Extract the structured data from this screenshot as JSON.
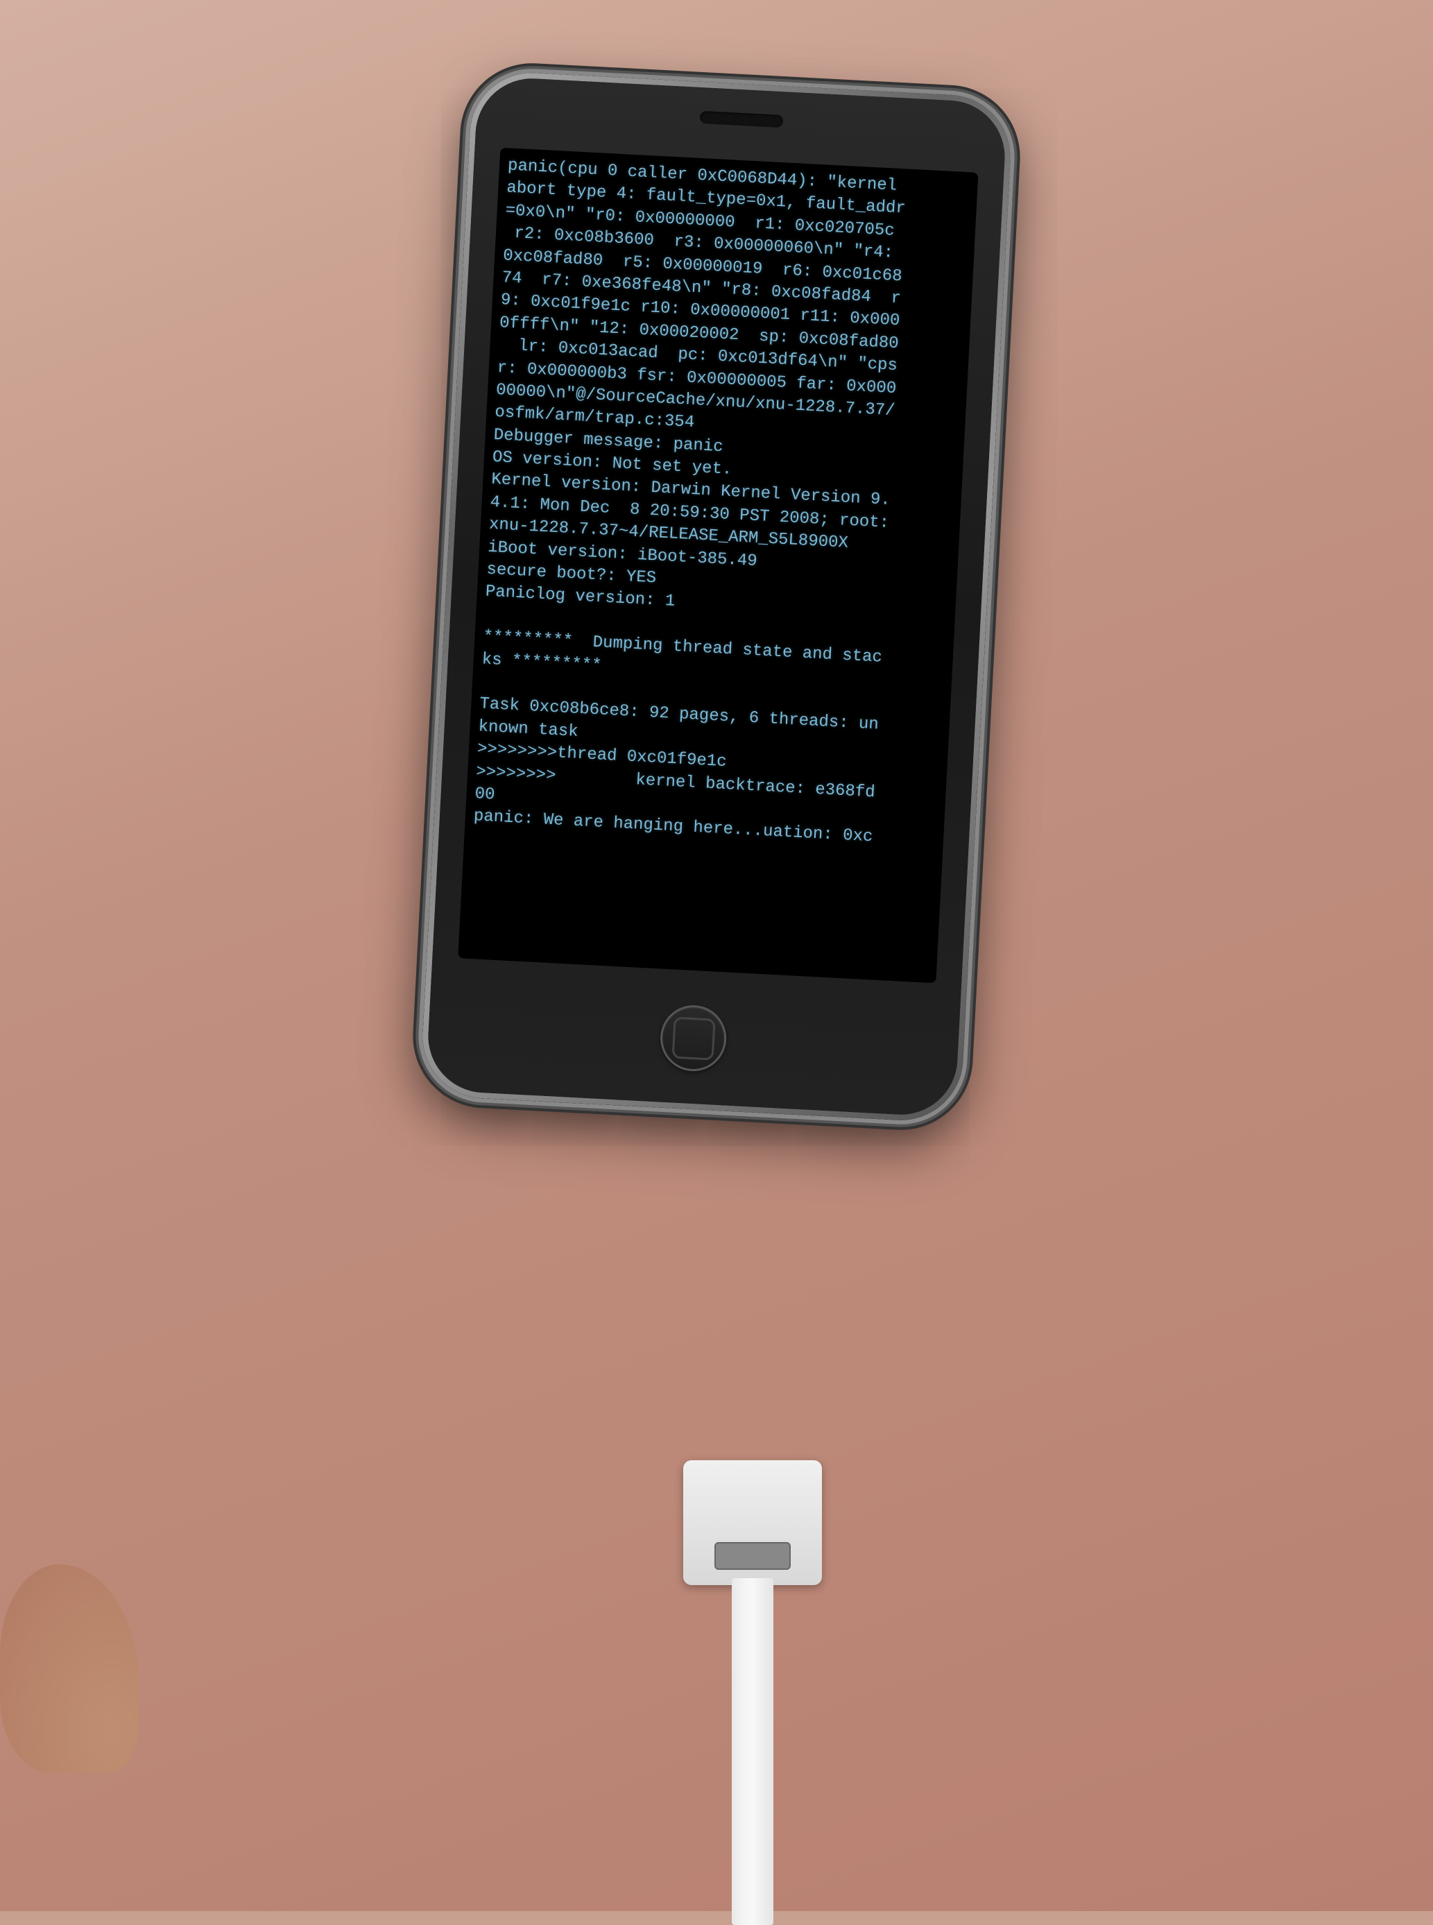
{
  "scene": {
    "background_color": "#c8a090",
    "description": "iPhone showing kernel panic screen, connected via USB cable"
  },
  "phone": {
    "model": "iPhone (original / 2G)",
    "screen": {
      "background": "#000000",
      "text_color": "#7ab8d4"
    },
    "panic_text": "panic(cpu 0 caller 0xC0068D44): \"kernel\nabort type 4: fault_type=0x1, fault_addr\n=0x0\\n\" \"r0: 0x00000000  r1: 0xc020705c\n r2: 0xc08b3600  r3: 0x00000060\\n\" \"r4:\n0xc08fad80  r5: 0x00000019  r6: 0xc01c68\n74  r7: 0xe368fe48\\n\" \"r8: 0xc08fad84  r\n9: 0xc01f9e1c r10: 0x00000001 r11: 0x000\n0ffff\\n\" \"12: 0x00020002  sp: 0xc08fad80\n  lr: 0xc013acad  pc: 0xc013df64\\n\" \"cps\nr: 0x000000b3 fsr: 0x00000005 far: 0x000\n00000\\n\"@/SourceCache/xnu/xnu-1228.7.37/\nosfmk/arm/trap.c:354\nDebugger message: panic\nOS version: Not set yet.\nKernel version: Darwin Kernel Version 9.\n4.1: Mon Dec  8 20:59:30 PST 2008; root:\nxnu-1228.7.37~4/RELEASE_ARM_S5L8900X\niBoot version: iBoot-385.49\nsecure boot?: YES\nPaniclog version: 1\n\n*********  Dumping thread state and stac\nks *********\n\nTask 0xc08b6ce8: 92 pages, 6 threads: un\nknown task\n>>>>>>>>thread 0xc01f9e1c\n>>>>>>>>        kernel backtrace: e368fd\n00\npanic: We are hanging here...uation: 0xc"
  },
  "cable": {
    "color": "#f0f0f0",
    "connector_label": "USB dock connector"
  }
}
